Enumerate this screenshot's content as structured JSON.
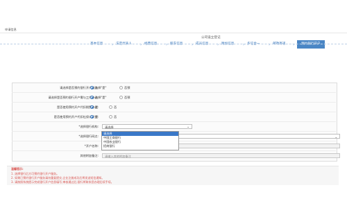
{
  "top_tab": {
    "label": "申请信息"
  },
  "steps_caption": "公司设立登记",
  "steps": [
    {
      "label": "基本信息",
      "active": false
    },
    {
      "label": "法定代表人",
      "active": false
    },
    {
      "label": "经营信息",
      "active": false
    },
    {
      "label": "股东信息",
      "active": false
    },
    {
      "label": "成员信息",
      "active": false
    },
    {
      "label": "附加信息",
      "active": false
    },
    {
      "label": "多证合一",
      "active": false
    },
    {
      "label": "邮政寄递",
      "active": false
    },
    {
      "label": "预约银行开户",
      "active": true
    }
  ],
  "form": {
    "row1": {
      "label": "请选择是否预约银行开户服务:",
      "opt_yes": "选择\"是\"",
      "opt_no": "否预"
    },
    "row2": {
      "label": "请选择是否预约银行开户需与工作协议:",
      "opt_yes": "选择\"是\"",
      "opt_no": "否预"
    },
    "row3": {
      "label": "是否使用预约开户代扣税费协议:",
      "opt_yes": "是",
      "opt_no": "否"
    },
    "row4": {
      "label": "是否使用预约开户代扣社保公积金:",
      "opt_yes": "是",
      "opt_no": "否"
    },
    "bank_type": {
      "label": "*选择银行机构:",
      "value": "请选择"
    },
    "branch": {
      "label": "*选择银行网点:",
      "value": ""
    },
    "account_name": {
      "label": "*开户名称:",
      "value": ""
    },
    "other_notes": {
      "label": "其他附加备注:",
      "placeholder": "请输入其他附加备注"
    }
  },
  "dropdown": {
    "options": [
      "请选择",
      "中国工商银行",
      "中国农业银行",
      "招商银行"
    ],
    "selected_index": 0
  },
  "notes": {
    "title": "温馨提示:",
    "lines": [
      "1. 选择银行后方可预约银行开户服务。",
      "2. 如果已预约银行开户服务请勿重复提交,企业注册成功后将发送短信通知。",
      "3. 请按照系统提示完成银行开户信息填写,审核通过后,银行将联系您办理后续手续。"
    ]
  },
  "colors": {
    "accent": "#4a86c5",
    "link": "#2f6fb7",
    "warning": "#d9534f"
  }
}
